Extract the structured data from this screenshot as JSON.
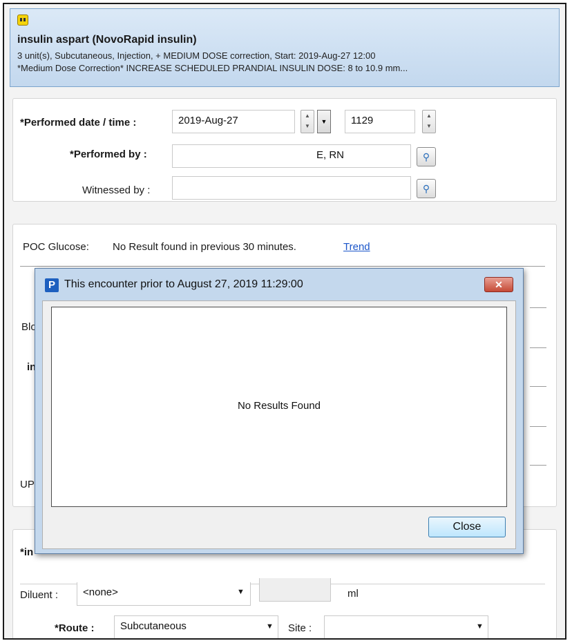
{
  "order": {
    "drug_name": "insulin aspart (NovoRapid insulin)",
    "line1": "3 unit(s), Subcutaneous, Injection, + MEDIUM DOSE correction, Start: 2019-Aug-27 12:00",
    "line2": "*Medium Dose Correction*   INCREASE SCHEDULED PRANDIAL INSULIN DOSE:   8 to 10.9 mm..."
  },
  "performed": {
    "date_label": "*Performed date / time :",
    "date_value": "2019-Aug-27",
    "time_value": "1129",
    "by_label": "*Performed by :",
    "by_value": "E, RN",
    "witness_label": "Witnessed by :",
    "witness_value": ""
  },
  "results": {
    "poc_label": "POC Glucose:",
    "poc_status": "No Result found in previous 30 minutes.",
    "trend_link": "Trend",
    "partial": [
      "Blo",
      "in",
      "UP",
      "*in"
    ]
  },
  "admin": {
    "diluent_label": "Diluent :",
    "diluent_value": "<none>",
    "diluent_unit": "ml",
    "route_label": "*Route :",
    "route_value": "Subcutaneous",
    "site_label": "Site :",
    "site_value": ""
  },
  "dialog": {
    "icon_letter": "P",
    "title": "This encounter prior to August 27, 2019 11:29:00",
    "close_glyph": "✕",
    "empty_message": "No Results Found",
    "close_button": "Close"
  },
  "icons": {
    "order_icon": "medication-task-icon",
    "lookup_icon": "magnifier-icon",
    "dropdown_icon": "chevron-down-icon",
    "spinner_icon": "spin-up-down-icon"
  },
  "colors": {
    "header_bg": "#c3d8ee",
    "dialog_frame": "#c4d8ed",
    "link": "#1a55c9",
    "close_red": "#c54a36"
  }
}
